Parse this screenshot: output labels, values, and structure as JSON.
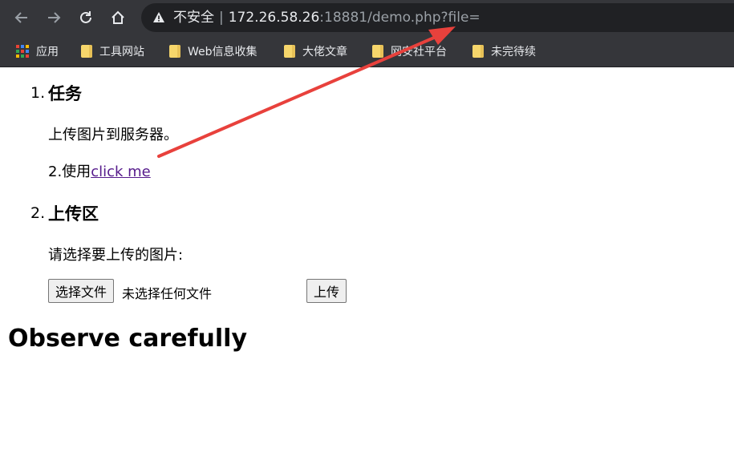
{
  "browser": {
    "address": {
      "security_label": "不安全",
      "host": "172.26.58.26",
      "rest": ":18881/demo.php?file="
    },
    "bookmarks": [
      {
        "label": "应用",
        "icon": "apps-grid-icon"
      },
      {
        "label": "工具网站",
        "icon": "folder-icon"
      },
      {
        "label": "Web信息收集",
        "icon": "folder-icon"
      },
      {
        "label": "大佬文章",
        "icon": "folder-icon"
      },
      {
        "label": "网安社平台",
        "icon": "folder-icon"
      },
      {
        "label": "未完待续",
        "icon": "folder-icon"
      }
    ]
  },
  "page": {
    "sections": [
      {
        "number": "1.",
        "heading": "任务"
      },
      {
        "number": "2.",
        "heading": "上传区"
      }
    ],
    "task_line1": "上传图片到服务器。",
    "task_line2_prefix": "2.使用",
    "task_link": "click me",
    "upload_prompt": "请选择要上传的图片:",
    "choose_file_button": "选择文件",
    "no_file_text": "未选择任何文件",
    "upload_button": "上传",
    "footer_heading": "Observe carefully"
  },
  "colors": {
    "toolbar_bg": "#35363a",
    "omnibox_bg": "#202124",
    "link": "#551a8b",
    "annotation_arrow": "#e8413c"
  }
}
